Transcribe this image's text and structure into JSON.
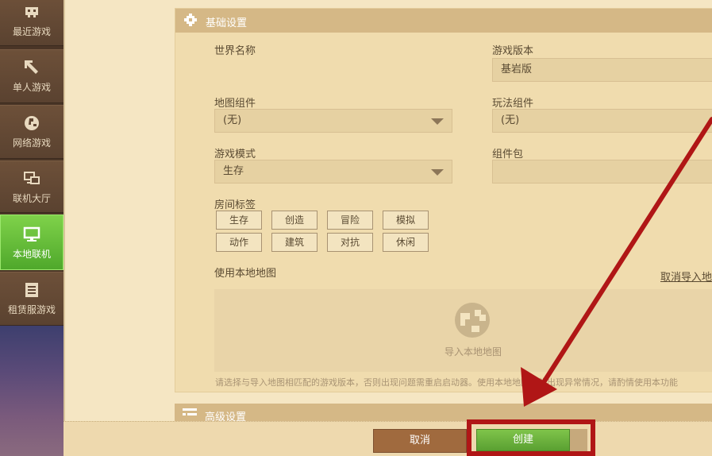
{
  "sidebar": {
    "items": [
      {
        "label": "最近游戏",
        "icon": "gamepad-icon"
      },
      {
        "label": "单人游戏",
        "icon": "pickaxe-icon"
      },
      {
        "label": "网络游戏",
        "icon": "globe-icon"
      },
      {
        "label": "联机大厅",
        "icon": "network-icon"
      },
      {
        "label": "本地联机",
        "icon": "monitor-icon"
      },
      {
        "label": "租赁服游戏",
        "icon": "server-list-icon"
      }
    ],
    "active_index": 4,
    "colors": {
      "active": "#5bb232",
      "normal": "#5f4532"
    }
  },
  "basic_settings": {
    "title": "基础设置",
    "world_name": {
      "label": "世界名称",
      "value": ""
    },
    "game_version": {
      "label": "游戏版本",
      "value": "基岩版"
    },
    "map_component": {
      "label": "地图组件",
      "value": "(无)"
    },
    "play_component": {
      "label": "玩法组件",
      "value": "(无)"
    },
    "game_mode": {
      "label": "游戏模式",
      "value": "生存"
    },
    "component_pack": {
      "label": "组件包",
      "value": ""
    },
    "room_tags": {
      "label": "房间标签",
      "tags": [
        "生存",
        "创造",
        "冒险",
        "模拟",
        "动作",
        "建筑",
        "对抗",
        "休闲"
      ]
    },
    "local_map": {
      "label": "使用本地地图",
      "cancel_import": "取消导入地",
      "import_label": "导入本地地图",
      "hint": "请选择与导入地图相匹配的游戏版本，否则出现问题需重启启动器。使用本地地图可能出现异常情况，请酌情使用本功能"
    }
  },
  "advanced_settings": {
    "title": "高级设置"
  },
  "footer": {
    "cancel_label": "取消",
    "create_label": "创建"
  },
  "annotation": {
    "color": "#b01616"
  }
}
